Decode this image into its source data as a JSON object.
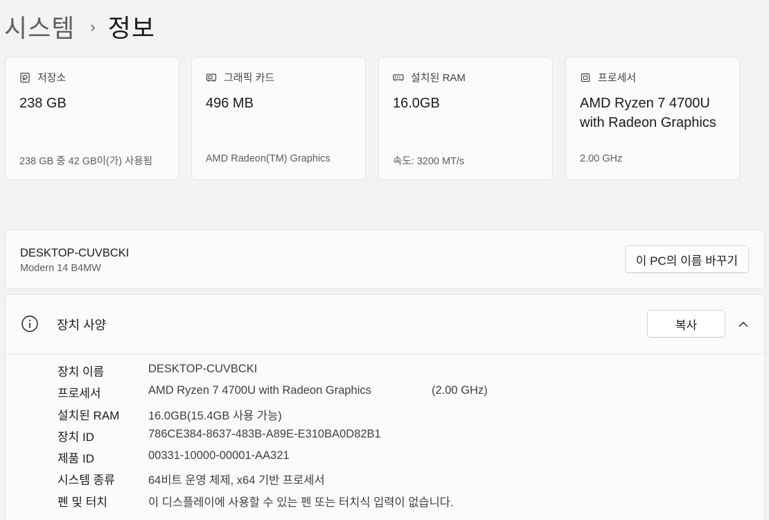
{
  "breadcrumb": {
    "parent": "시스템",
    "separator": "›",
    "current": "정보"
  },
  "cards": [
    {
      "icon": "storage-icon",
      "label": "저장소",
      "value": "238 GB",
      "sub": "238 GB 중 42 GB이(가) 사용됨"
    },
    {
      "icon": "graphics-card-icon",
      "label": "그래픽 카드",
      "value": "496 MB",
      "sub": "AMD Radeon(TM) Graphics"
    },
    {
      "icon": "ram-icon",
      "label": "설치된 RAM",
      "value": "16.0GB",
      "sub": "속도: 3200 MT/s"
    },
    {
      "icon": "processor-icon",
      "label": "프로세서",
      "value": "AMD Ryzen 7 4700U with Radeon Graphics",
      "sub": "2.00 GHz"
    }
  ],
  "device": {
    "name": "DESKTOP-CUVBCKI",
    "model": "Modern 14 B4MW",
    "rename_label": "이 PC의 이름 바꾸기"
  },
  "specs": {
    "title": "장치 사양",
    "copy_label": "복사",
    "rows": [
      {
        "key": "장치 이름",
        "value": "DESKTOP-CUVBCKI",
        "extra": ""
      },
      {
        "key": "프로세서",
        "value": "AMD Ryzen 7 4700U with Radeon Graphics",
        "extra": "(2.00 GHz)"
      },
      {
        "key": "설치된 RAM",
        "value": "16.0GB(15.4GB 사용 가능)",
        "extra": ""
      },
      {
        "key": "장치 ID",
        "value": "786CE384-8637-483B-A89E-E310BA0D82B1",
        "extra": ""
      },
      {
        "key": "제품 ID",
        "value": "00331-10000-00001-AA321",
        "extra": ""
      },
      {
        "key": "시스템 종류",
        "value": "64비트 운영 체제, x64 기반 프로세서",
        "extra": ""
      },
      {
        "key": "펜 및 터치",
        "value": "이 디스플레이에 사용할 수 있는 펜 또는 터치식 입력이 없습니다.",
        "extra": ""
      }
    ]
  }
}
